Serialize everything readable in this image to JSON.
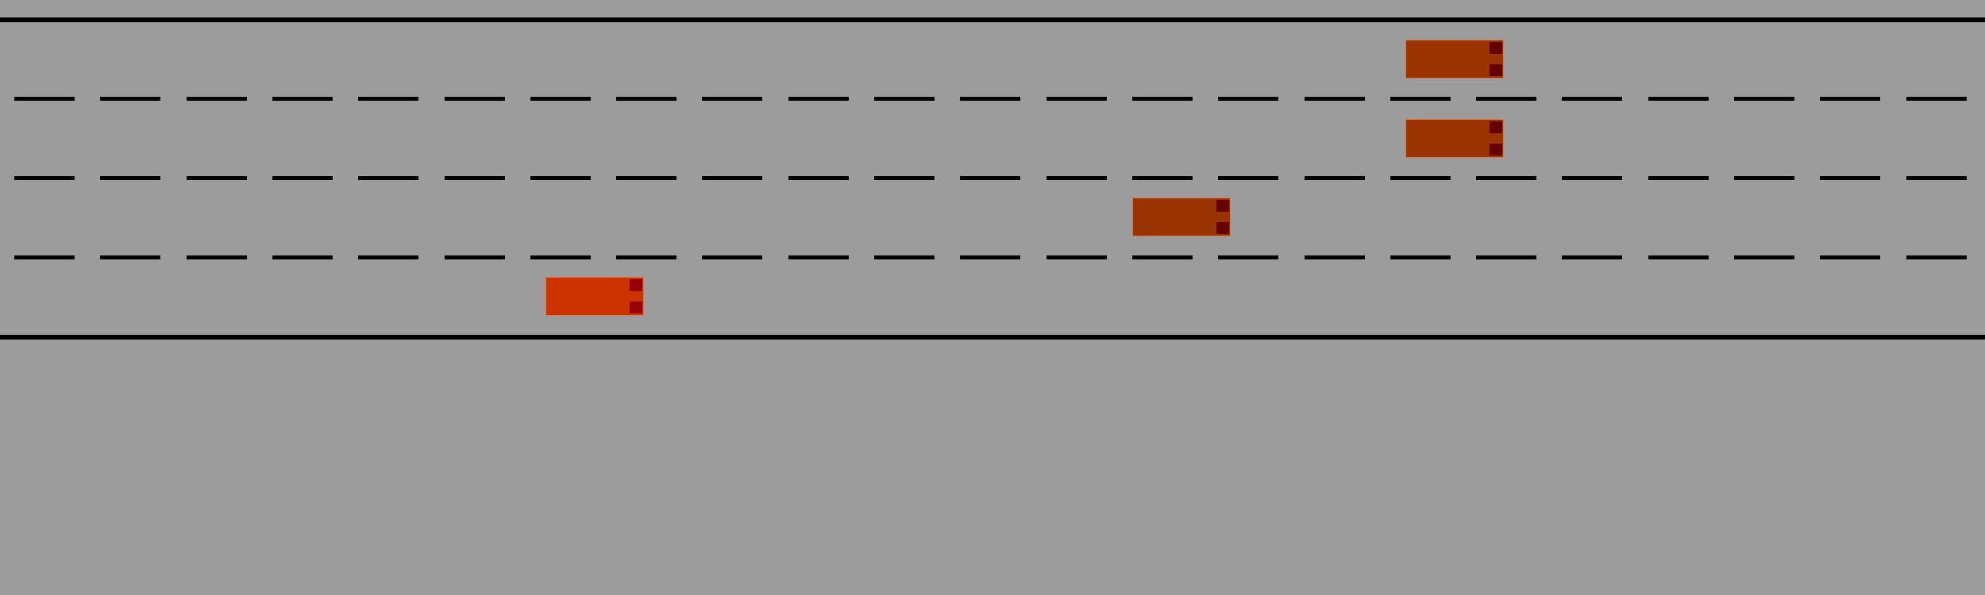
{
  "scene": {
    "road_color": "#9c9c9c",
    "marking_color": "#000000",
    "lane_count": 4
  },
  "vehicles": [
    {
      "id": "ego",
      "lane": 4,
      "color": "#cc3300",
      "light_color": "#990000"
    },
    {
      "id": "other-1",
      "lane": 1,
      "color": "#993300",
      "light_color": "#660000"
    },
    {
      "id": "other-2",
      "lane": 2,
      "color": "#993300",
      "light_color": "#660000"
    },
    {
      "id": "other-3",
      "lane": 3,
      "color": "#993300",
      "light_color": "#660000"
    }
  ]
}
